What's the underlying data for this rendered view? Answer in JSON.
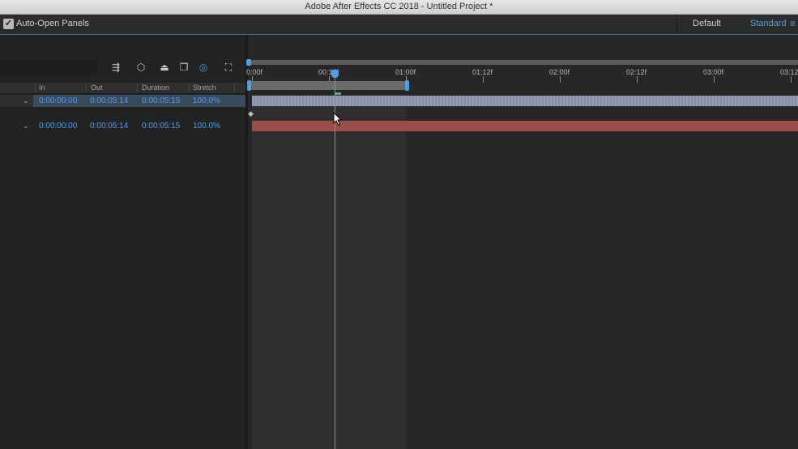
{
  "window": {
    "title": "Adobe After Effects CC 2018 - Untitled Project *"
  },
  "toolbar": {
    "auto_open_label": "Auto-Open Panels",
    "auto_open_checked": true,
    "workspaces": [
      "Default",
      "Standard"
    ],
    "active_workspace": "Standard",
    "accent_color": "#4a9ff0"
  },
  "timeline": {
    "columns": [
      "In",
      "Out",
      "Duration",
      "Stretch"
    ],
    "rows": [
      {
        "in": "0:00:00:00",
        "out": "0:00:05:14",
        "duration": "0:00:05:15",
        "stretch": "100.0%",
        "bar_color": "#8e96ad"
      },
      {
        "in": "0:00:00:00",
        "out": "0:00:05:14",
        "duration": "0:00:05:15",
        "stretch": "100.0%",
        "bar_color": "#9a4e4c"
      }
    ],
    "ruler_labels": [
      "0:00f",
      "00:12f",
      "01:00f",
      "01:12f",
      "02:00f",
      "02:12f",
      "03:00f",
      "03:12"
    ],
    "panel_icons": [
      "flowchart-icon",
      "3d-layer-icon",
      "solo-icon",
      "frame-blend-icon",
      "motion-blur-icon",
      "graph-editor-icon"
    ]
  }
}
